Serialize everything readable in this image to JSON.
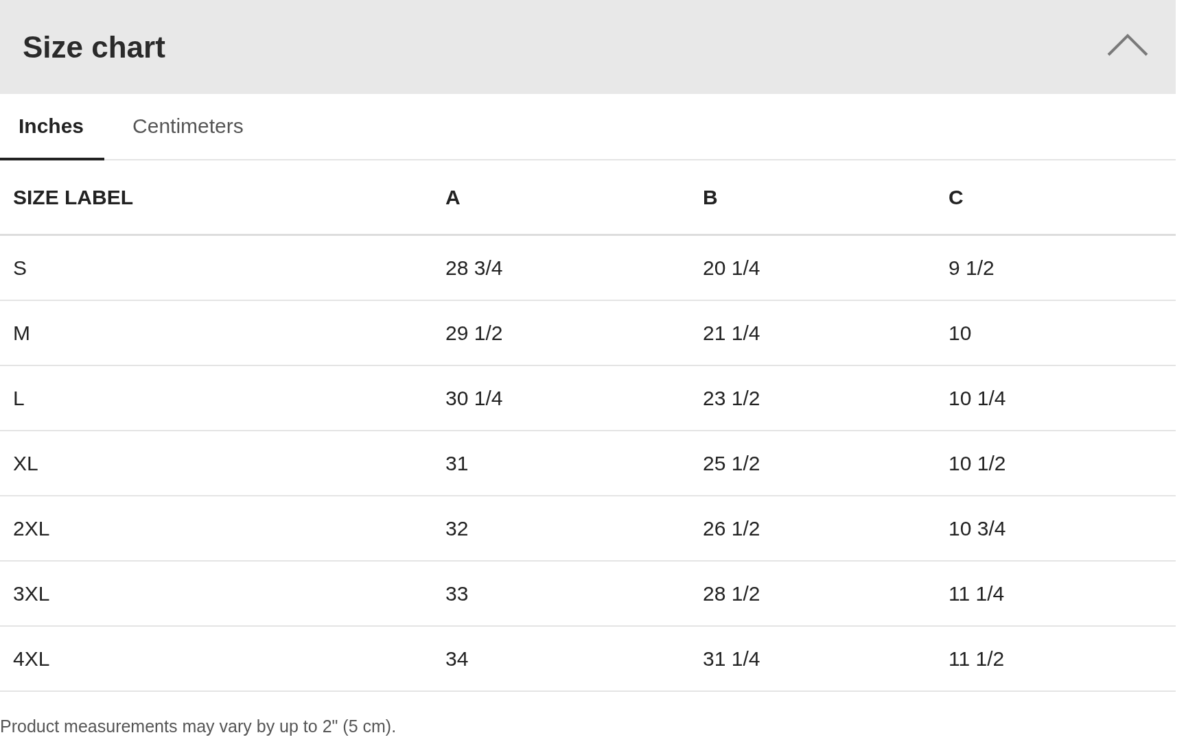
{
  "header": {
    "title": "Size chart",
    "expanded": true
  },
  "tabs": [
    {
      "label": "Inches",
      "selected": true
    },
    {
      "label": "Centimeters",
      "selected": false
    }
  ],
  "table": {
    "columns": [
      "SIZE LABEL",
      "A",
      "B",
      "C"
    ],
    "rows": [
      [
        "S",
        "28 3/4",
        "20 1/4",
        "9 1/2"
      ],
      [
        "M",
        "29 1/2",
        "21 1/4",
        "10"
      ],
      [
        "L",
        "30 1/4",
        "23 1/2",
        "10 1/4"
      ],
      [
        "XL",
        "31",
        "25 1/2",
        "10 1/2"
      ],
      [
        "2XL",
        "32",
        "26 1/2",
        "10 3/4"
      ],
      [
        "3XL",
        "33",
        "28 1/2",
        "11 1/4"
      ],
      [
        "4XL",
        "34",
        "31 1/4",
        "11 1/2"
      ]
    ]
  },
  "note": "Product measurements may vary by up to 2\" (5 cm)."
}
